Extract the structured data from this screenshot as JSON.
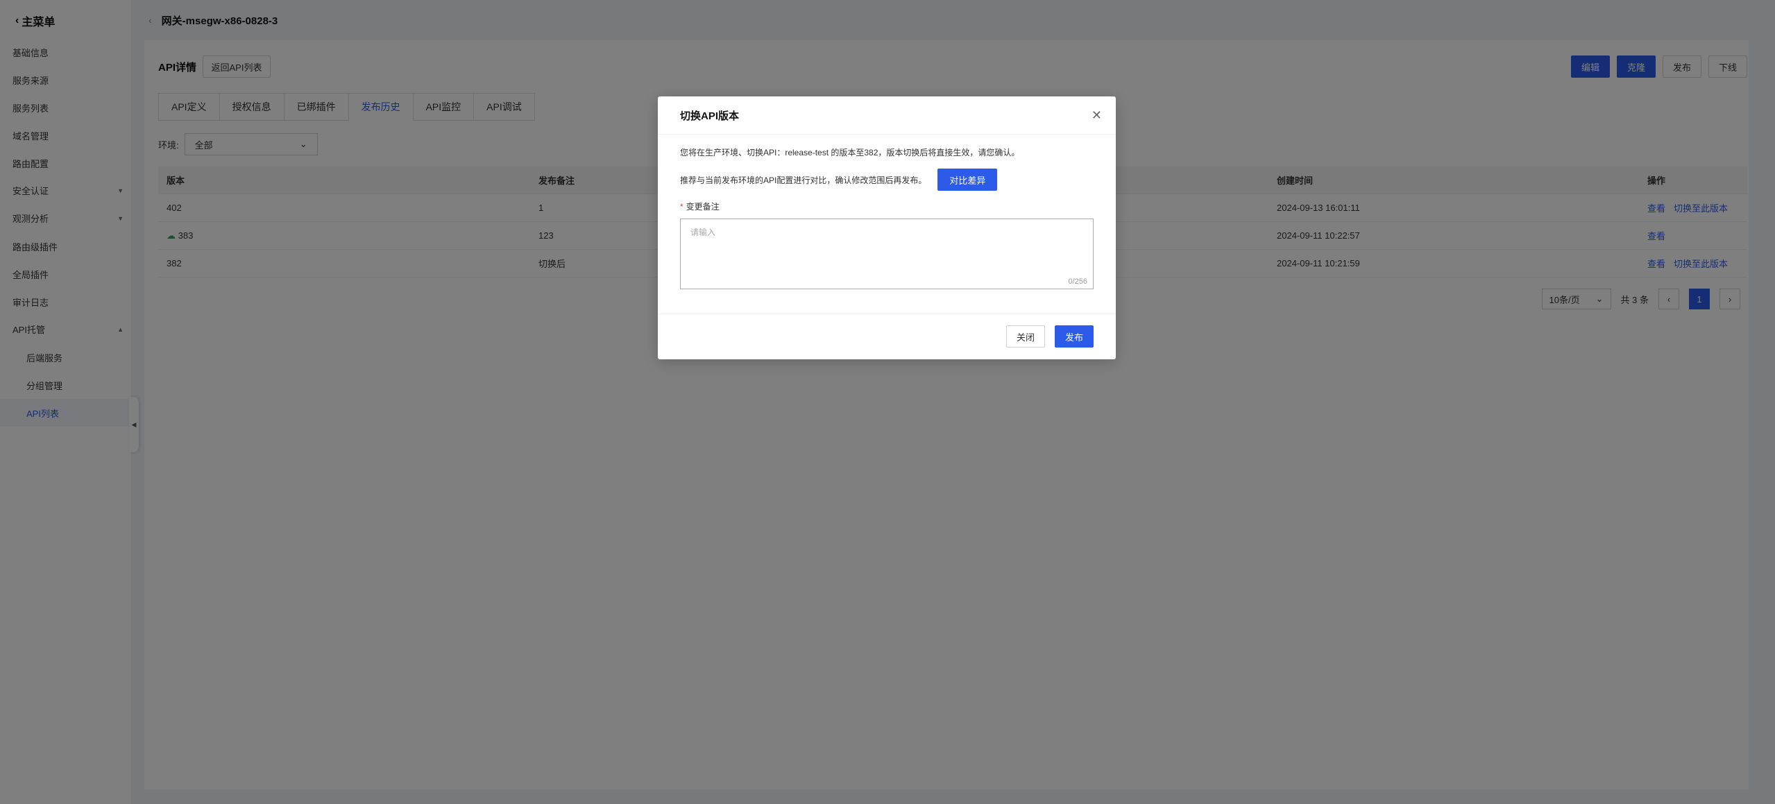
{
  "sidebar": {
    "back_label": "主菜单",
    "items": [
      {
        "label": "基础信息"
      },
      {
        "label": "服务来源"
      },
      {
        "label": "服务列表"
      },
      {
        "label": "域名管理"
      },
      {
        "label": "路由配置"
      },
      {
        "label": "安全认证"
      },
      {
        "label": "观测分析"
      },
      {
        "label": "路由级插件"
      },
      {
        "label": "全局插件"
      },
      {
        "label": "审计日志"
      },
      {
        "label": "API托管"
      },
      {
        "label": "后端服务"
      },
      {
        "label": "分组管理"
      },
      {
        "label": "API列表"
      }
    ]
  },
  "header": {
    "title": "网关-msegw-x86-0828-3"
  },
  "main": {
    "section_title": "API详情",
    "back_button": "返回API列表",
    "actions": {
      "edit": "编辑",
      "clone": "克隆",
      "publish": "发布",
      "offline": "下线"
    },
    "tabs": [
      "API定义",
      "授权信息",
      "已绑插件",
      "发布历史",
      "API监控",
      "API调试"
    ],
    "env_label": "环境:",
    "env_value": "全部",
    "table": {
      "columns": [
        "版本",
        "发布备注",
        "",
        "创建时间",
        "操作"
      ],
      "rows": [
        {
          "version": "402",
          "note": "1",
          "created": "2024-09-13 16:01:11",
          "view": "查看",
          "switch": "切换至此版本"
        },
        {
          "version": "383",
          "note": "123",
          "created": "2024-09-11 10:22:57",
          "view": "查看",
          "switch": ""
        },
        {
          "version": "382",
          "note": "切换后",
          "created": "2024-09-11 10:21:59",
          "view": "查看",
          "switch": "切换至此版本"
        }
      ]
    },
    "pager": {
      "page_size": "10条/页",
      "total": "共 3 条",
      "current": "1"
    }
  },
  "modal": {
    "title": "切换API版本",
    "info": "您将在生产环境、切换API：release-test 的版本至382，版本切换后将直接生效，请您确认。",
    "recommend": "推荐与当前发布环境的API配置进行对比，确认修改范围后再发布。",
    "compare_button": "对比差异",
    "field_label": "变更备注",
    "placeholder": "请输入",
    "count": "0/256",
    "close_button": "关闭",
    "publish_button": "发布"
  },
  "colors": {
    "primary": "#2b5be8",
    "success": "#2e9e5a"
  }
}
